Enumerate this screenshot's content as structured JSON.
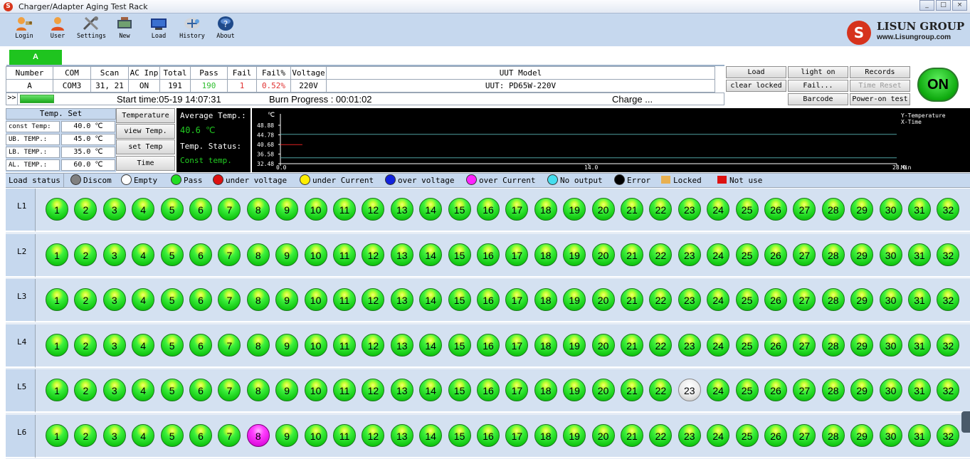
{
  "window": {
    "title": "Charger/Adapter Aging Test Rack",
    "controls": [
      "_",
      "□",
      "×"
    ]
  },
  "toolbar": {
    "items": [
      {
        "label": "Login",
        "icon": "login-icon"
      },
      {
        "label": "User",
        "icon": "user-icon"
      },
      {
        "label": "Settings",
        "icon": "settings-icon"
      },
      {
        "label": "New",
        "icon": "new-icon"
      },
      {
        "label": "Load",
        "icon": "load-icon"
      },
      {
        "label": "History",
        "icon": "history-icon"
      },
      {
        "label": "About",
        "icon": "about-icon"
      }
    ]
  },
  "brand": {
    "mark": "S",
    "name": "LISUN GROUP",
    "url": "www.Lisungroup.com",
    "color": "#d6331d"
  },
  "tab": {
    "label": "A",
    "color": "#1fc41f"
  },
  "info": {
    "headers": [
      "Number",
      "COM",
      "Scan",
      "AC Inp",
      "Total",
      "Pass",
      "Fail",
      "Fail%",
      "Voltage",
      "UUT Model"
    ],
    "values": [
      "A",
      "COM3",
      "31, 21",
      "ON",
      "191",
      "190",
      "1",
      "0.52%",
      "220V",
      "UUT: PD65W-220V"
    ],
    "pass_color": "#2fbf2f",
    "fail_color": "#e03030"
  },
  "progress": {
    "arrow": ">>",
    "start": "Start time:05-19 14:07:31",
    "burn": "Burn Progress : 00:01:02",
    "status": "Charge ..."
  },
  "buttons": {
    "load": "Load",
    "light_on": "light on",
    "records": "Records",
    "clear_locked": "clear locked",
    "fail": "Fail...",
    "time_reset": "Time Reset",
    "barcode": "Barcode",
    "power_on_test": "Power-on test",
    "on": "ON"
  },
  "temp_set": {
    "header": "Temp. Set",
    "rows": [
      {
        "key": "const Temp:",
        "value": "40.0 ℃"
      },
      {
        "key": "UB. TEMP.:",
        "value": "45.0 ℃"
      },
      {
        "key": "LB. TEMP.:",
        "value": "35.0 ℃"
      },
      {
        "key": "AL. TEMP.:",
        "value": "60.0 ℃"
      }
    ]
  },
  "temp_buttons": [
    "Temperature",
    "view Temp.",
    "set Temp",
    "Time"
  ],
  "avg": {
    "label": "Average Temp.:",
    "value": "40.6 ℃",
    "status_label": "Temp. Status:",
    "status_value": "Const temp."
  },
  "chart_data": {
    "type": "line",
    "ylabel": "℃",
    "ytick_labels": [
      "48.88",
      "44.78",
      "40.68",
      "36.58",
      "32.48"
    ],
    "xtick_labels": [
      "0.0",
      "14.0",
      "28.0"
    ],
    "xunit": "Min",
    "ylim": [
      32.48,
      48.88
    ],
    "xlim": [
      0,
      28
    ],
    "series": [
      {
        "name": "UB",
        "values": [
          45.0,
          45.0
        ],
        "color": "#4fa0a0"
      },
      {
        "name": "LB",
        "values": [
          35.0,
          35.0
        ],
        "color": "#4fa0a0"
      },
      {
        "name": "Temp",
        "values": [
          40.6,
          40.6
        ],
        "color": "#e02020",
        "x": [
          0,
          1.0
        ]
      }
    ],
    "legend": [
      "Y-Temperature",
      "X-Time"
    ]
  },
  "legend": {
    "title": "Load status",
    "items": [
      {
        "label": "Discom",
        "color": "#808080",
        "shape": "dot"
      },
      {
        "label": "Empty",
        "color": "#ffffff",
        "shape": "dot"
      },
      {
        "label": "Pass",
        "color": "#22dd22",
        "shape": "dot"
      },
      {
        "label": "under voltage",
        "color": "#dd1111",
        "shape": "dot"
      },
      {
        "label": "under Current",
        "color": "#ffee00",
        "shape": "dot"
      },
      {
        "label": "over voltage",
        "color": "#1122dd",
        "shape": "dot"
      },
      {
        "label": "over Current",
        "color": "#ff22ff",
        "shape": "dot"
      },
      {
        "label": "No output",
        "color": "#44ddee",
        "shape": "dot"
      },
      {
        "label": "Error",
        "color": "#000000",
        "shape": "dot"
      },
      {
        "label": "Locked",
        "color": "#e8b050",
        "shape": "sq"
      },
      {
        "label": "Not use",
        "color": "#dd1111",
        "shape": "sq"
      }
    ]
  },
  "rows": [
    {
      "label": "L1",
      "special": {}
    },
    {
      "label": "L2",
      "special": {}
    },
    {
      "label": "L3",
      "special": {}
    },
    {
      "label": "L4",
      "special": {}
    },
    {
      "label": "L5",
      "special": {
        "23": "empty"
      }
    },
    {
      "label": "L6",
      "special": {
        "8": "ocur"
      }
    }
  ],
  "slots": [
    "1",
    "2",
    "3",
    "4",
    "5",
    "6",
    "7",
    "8",
    "9",
    "10",
    "11",
    "12",
    "13",
    "14",
    "15",
    "16",
    "17",
    "18",
    "19",
    "20",
    "21",
    "22",
    "23",
    "24",
    "25",
    "26",
    "27",
    "28",
    "29",
    "30",
    "31",
    "32"
  ]
}
